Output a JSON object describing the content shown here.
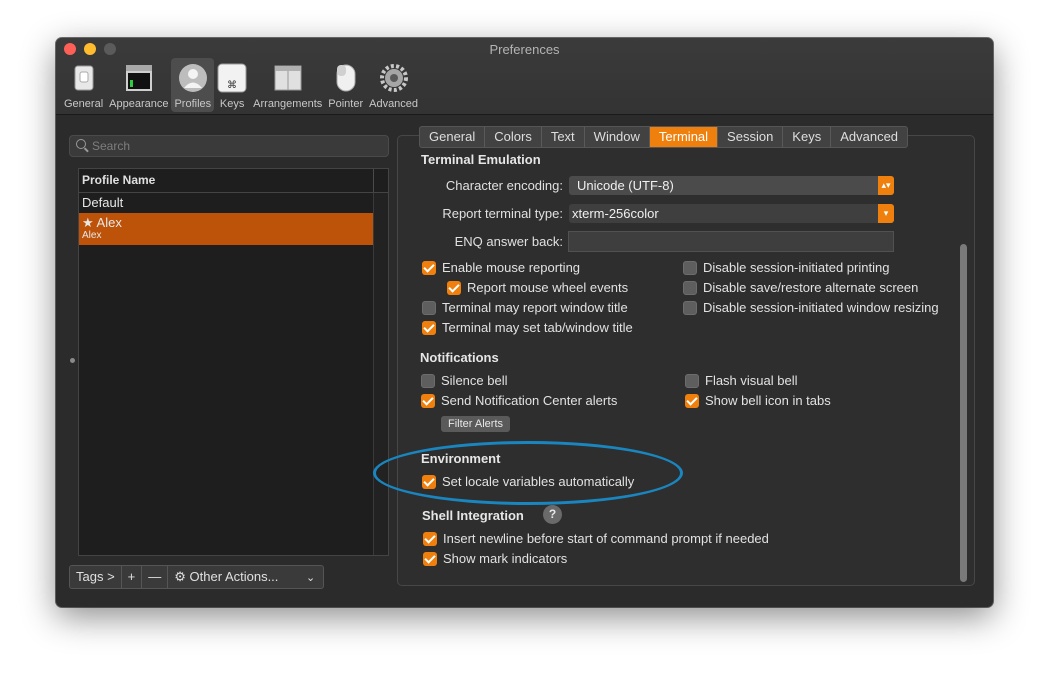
{
  "window": {
    "title": "Preferences"
  },
  "toolbar": {
    "items": [
      {
        "label": "General",
        "icon": "general-switch-icon"
      },
      {
        "label": "Appearance",
        "icon": "appearance-window-icon"
      },
      {
        "label": "Profiles",
        "icon": "profiles-person-icon",
        "active": true
      },
      {
        "label": "Keys",
        "icon": "keys-command-icon"
      },
      {
        "label": "Arrangements",
        "icon": "arrangements-icon"
      },
      {
        "label": "Pointer",
        "icon": "pointer-mouse-icon"
      },
      {
        "label": "Advanced",
        "icon": "advanced-gear-icon"
      }
    ]
  },
  "search": {
    "placeholder": "Search"
  },
  "profiles": {
    "header": "Profile Name",
    "default_name": "Default",
    "selected_name": "★ Alex",
    "selected_sub": "Alex"
  },
  "bottombar": {
    "tags": "Tags >",
    "add": "+",
    "remove": "—",
    "other_actions": "⚙ Other Actions...",
    "chevron": "⌄"
  },
  "tabs": [
    "General",
    "Colors",
    "Text",
    "Window",
    "Terminal",
    "Session",
    "Keys",
    "Advanced"
  ],
  "active_tab": "Terminal",
  "terminal_emulation": {
    "title": "Terminal Emulation",
    "encoding_label": "Character encoding:",
    "encoding_value": "Unicode (UTF-8)",
    "report_type_label": "Report terminal type:",
    "report_type_value": "xterm-256color",
    "enq_label": "ENQ answer back:",
    "enq_value": ""
  },
  "checkboxes": {
    "enable_mouse_reporting": {
      "label": "Enable mouse reporting",
      "checked": true
    },
    "report_mouse_wheel": {
      "label": "Report mouse wheel events",
      "checked": true
    },
    "report_window_title": {
      "label": "Terminal may report window title",
      "checked": false
    },
    "set_tab_title": {
      "label": "Terminal may set tab/window title",
      "checked": true
    },
    "disable_printing": {
      "label": "Disable session-initiated printing",
      "checked": false
    },
    "disable_alt_screen": {
      "label": "Disable save/restore alternate screen",
      "checked": false
    },
    "disable_resizing": {
      "label": "Disable session-initiated window resizing",
      "checked": false
    }
  },
  "notifications": {
    "title": "Notifications",
    "silence_bell": {
      "label": "Silence bell",
      "checked": false
    },
    "send_alerts": {
      "label": "Send Notification Center alerts",
      "checked": true
    },
    "flash_bell": {
      "label": "Flash visual bell",
      "checked": false
    },
    "bell_icon": {
      "label": "Show bell icon in tabs",
      "checked": true
    },
    "filter_button": "Filter Alerts"
  },
  "environment": {
    "title": "Environment",
    "set_locale": {
      "label": "Set locale variables automatically",
      "checked": true
    }
  },
  "shell_integration": {
    "title": "Shell Integration",
    "help": "?",
    "insert_newline": {
      "label": "Insert newline before start of command prompt if needed",
      "checked": true
    },
    "show_marks": {
      "label": "Show mark indicators",
      "checked": true
    }
  },
  "colors": {
    "accent": "#f0800d",
    "selection": "#bd5209",
    "annotation": "#1a86c0"
  }
}
